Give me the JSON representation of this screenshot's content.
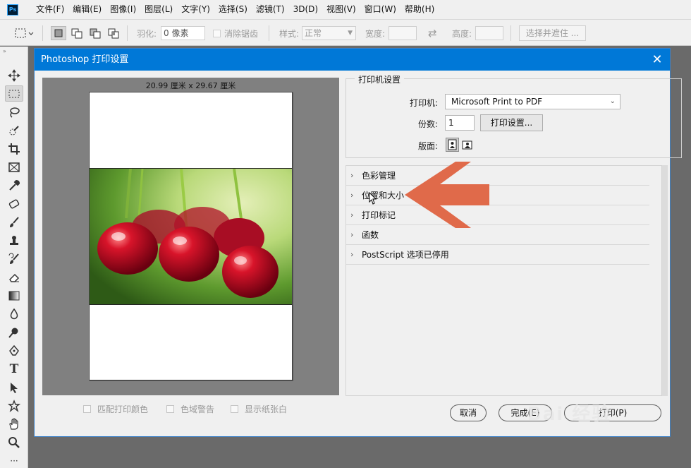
{
  "app": {
    "logo_text": "Ps"
  },
  "menu": [
    "文件(F)",
    "编辑(E)",
    "图像(I)",
    "图层(L)",
    "文字(Y)",
    "选择(S)",
    "滤镜(T)",
    "3D(D)",
    "视图(V)",
    "窗口(W)",
    "帮助(H)"
  ],
  "options": {
    "feather_label": "羽化:",
    "feather_value": "0 像素",
    "antialias_label": "消除锯齿",
    "style_label": "样式:",
    "style_value": "正常",
    "width_label": "宽度:",
    "height_label": "高度:",
    "select_mask_button": "选择并遮住 ..."
  },
  "dialog": {
    "title": "Photoshop 打印设置",
    "close_glyph": "✕",
    "paper_size": "20.99 厘米 x 29.67 厘米",
    "checkboxes": [
      "匹配打印颜色",
      "色域警告",
      "显示纸张白"
    ],
    "printer_group_title": "打印机设置",
    "printer_label": "打印机:",
    "printer_value": "Microsoft Print to PDF",
    "copies_label": "份数:",
    "copies_value": "1",
    "print_settings_button": "打印设置...",
    "layout_label": "版面:",
    "sections": [
      "色彩管理",
      "位置和大小",
      "打印标记",
      "函数",
      "PostScript 选项已停用"
    ],
    "buttons": {
      "cancel": "取消",
      "done": "完成(E)",
      "print": "打印(P)"
    }
  },
  "watermark": "Bai 经验",
  "colors": {
    "titlebar": "#0078d7",
    "annotation_arrow": "#e06a4a"
  }
}
